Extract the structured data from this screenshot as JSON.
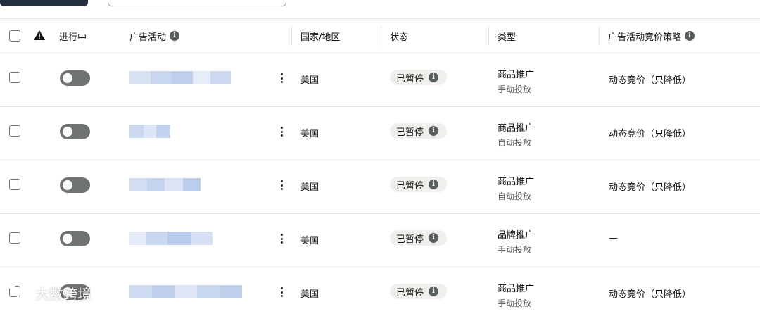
{
  "header": {
    "running_label": "进行中",
    "campaign_label": "广告活动",
    "country_label": "国家/地区",
    "status_label": "状态",
    "type_label": "类型",
    "strategy_label": "广告活动竞价策略"
  },
  "rows": [
    {
      "country": "美国",
      "status": "已暂停",
      "type": "商品推广",
      "targeting": "手动投放",
      "strategy": "动态竞价（只降低）"
    },
    {
      "country": "美国",
      "status": "已暂停",
      "type": "商品推广",
      "targeting": "自动投放",
      "strategy": "动态竞价（只降低）"
    },
    {
      "country": "美国",
      "status": "已暂停",
      "type": "商品推广",
      "targeting": "自动投放",
      "strategy": "动态竞价（只降低）"
    },
    {
      "country": "美国",
      "status": "已暂停",
      "type": "品牌推广",
      "targeting": "手动投放",
      "strategy": "—"
    },
    {
      "country": "美国",
      "status": "已暂停",
      "type": "商品推广",
      "targeting": "手动投放",
      "strategy": "动态竞价（只降低）"
    }
  ],
  "watermark": {
    "text": "大数跨境"
  },
  "icons": {
    "warning": "warning-triangle-icon",
    "info": "info-icon",
    "more": "kebab-menu-icon"
  },
  "colors": {
    "toggle_off": "#6f7373",
    "pill_bg": "#f0efec",
    "divider": "#e3e6e6"
  }
}
